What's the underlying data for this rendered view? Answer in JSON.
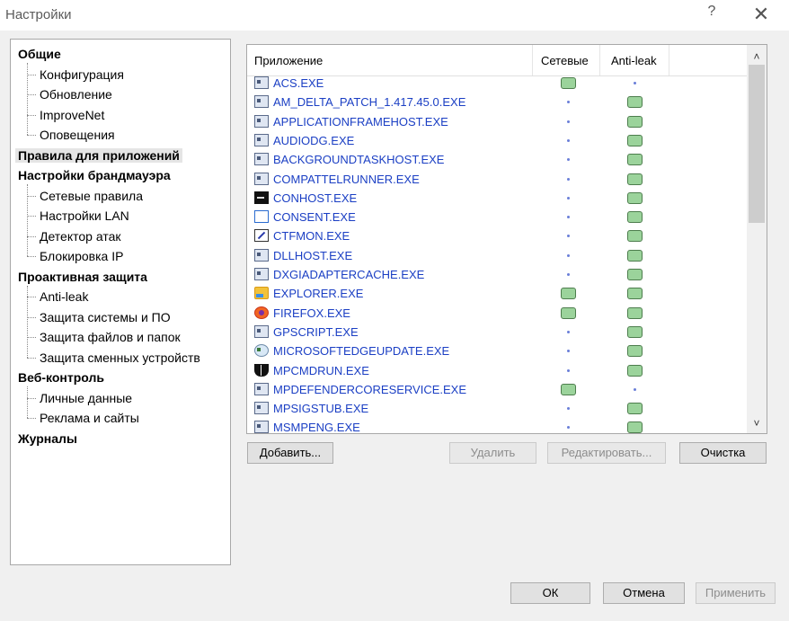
{
  "window": {
    "title": "Настройки",
    "help_glyph": "?",
    "close_glyph": "✕"
  },
  "tree": [
    {
      "type": "cat",
      "label": "Общие"
    },
    {
      "type": "child",
      "label": "Конфигурация"
    },
    {
      "type": "child",
      "label": "Обновление"
    },
    {
      "type": "child",
      "label": "ImproveNet"
    },
    {
      "type": "child",
      "label": "Оповещения"
    },
    {
      "type": "cat",
      "label": "Правила для приложений",
      "selected": true
    },
    {
      "type": "cat",
      "label": "Настройки брандмауэра"
    },
    {
      "type": "child",
      "label": "Сетевые правила"
    },
    {
      "type": "child",
      "label": "Настройки LAN"
    },
    {
      "type": "child",
      "label": "Детектор атак"
    },
    {
      "type": "child",
      "label": "Блокировка IP"
    },
    {
      "type": "cat",
      "label": "Проактивная защита"
    },
    {
      "type": "child",
      "label": "Anti-leak"
    },
    {
      "type": "child",
      "label": "Защита системы и ПО"
    },
    {
      "type": "child",
      "label": "Защита файлов и папок"
    },
    {
      "type": "child",
      "label": "Защита сменных устройств"
    },
    {
      "type": "cat",
      "label": "Веб-контроль"
    },
    {
      "type": "child",
      "label": "Личные данные"
    },
    {
      "type": "child",
      "label": "Реклама и сайты"
    },
    {
      "type": "cat",
      "label": "Журналы"
    }
  ],
  "table": {
    "columns": [
      "Приложение",
      "Сетевые",
      "Anti-leak"
    ],
    "rows": [
      {
        "name": "ACS.EXE",
        "icon": "app-window-icon",
        "network": "allow",
        "antileak": "none"
      },
      {
        "name": "AM_DELTA_PATCH_1.417.45.0.EXE",
        "icon": "app-window-icon",
        "network": "none",
        "antileak": "allow"
      },
      {
        "name": "APPLICATIONFRAMEHOST.EXE",
        "icon": "app-window-icon",
        "network": "none",
        "antileak": "allow"
      },
      {
        "name": "AUDIODG.EXE",
        "icon": "app-window-icon",
        "network": "none",
        "antileak": "allow"
      },
      {
        "name": "BACKGROUNDTASKHOST.EXE",
        "icon": "app-window-icon",
        "network": "none",
        "antileak": "allow"
      },
      {
        "name": "COMPATTELRUNNER.EXE",
        "icon": "app-window-icon",
        "network": "none",
        "antileak": "allow"
      },
      {
        "name": "CONHOST.EXE",
        "icon": "console-icon",
        "network": "none",
        "antileak": "allow"
      },
      {
        "name": "CONSENT.EXE",
        "icon": "blank-window-icon",
        "network": "none",
        "antileak": "allow"
      },
      {
        "name": "CTFMON.EXE",
        "icon": "pen-icon",
        "network": "none",
        "antileak": "allow"
      },
      {
        "name": "DLLHOST.EXE",
        "icon": "app-window-icon",
        "network": "none",
        "antileak": "allow"
      },
      {
        "name": "DXGIADAPTERCACHE.EXE",
        "icon": "app-window-icon",
        "network": "none",
        "antileak": "allow"
      },
      {
        "name": "EXPLORER.EXE",
        "icon": "folder-icon",
        "network": "allow",
        "antileak": "allow"
      },
      {
        "name": "FIREFOX.EXE",
        "icon": "firefox-icon",
        "network": "allow",
        "antileak": "allow"
      },
      {
        "name": "GPSCRIPT.EXE",
        "icon": "app-window-icon",
        "network": "none",
        "antileak": "allow"
      },
      {
        "name": "MICROSOFTEDGEUPDATE.EXE",
        "icon": "globe-icon",
        "network": "none",
        "antileak": "allow"
      },
      {
        "name": "MPCMDRUN.EXE",
        "icon": "shield-icon",
        "network": "none",
        "antileak": "allow"
      },
      {
        "name": "MPDEFENDERCORESERVICE.EXE",
        "icon": "app-window-icon",
        "network": "allow",
        "antileak": "none"
      },
      {
        "name": "MPSIGSTUB.EXE",
        "icon": "app-window-icon",
        "network": "none",
        "antileak": "allow"
      },
      {
        "name": "MSMPENG.EXE",
        "icon": "app-window-icon",
        "network": "none",
        "antileak": "allow"
      }
    ]
  },
  "scroll": {
    "up_glyph": "˄",
    "down_glyph": "˅"
  },
  "buttons": {
    "add": "Добавить...",
    "delete": "Удалить",
    "edit": "Редактировать...",
    "clear": "Очистка",
    "ok": "ОК",
    "cancel": "Отмена",
    "apply": "Применить"
  },
  "colors": {
    "link": "#1b3fc4",
    "allow_mark": "#9bd39b",
    "none_dot": "#6a7fd8",
    "selection": "#e5e5e5"
  }
}
